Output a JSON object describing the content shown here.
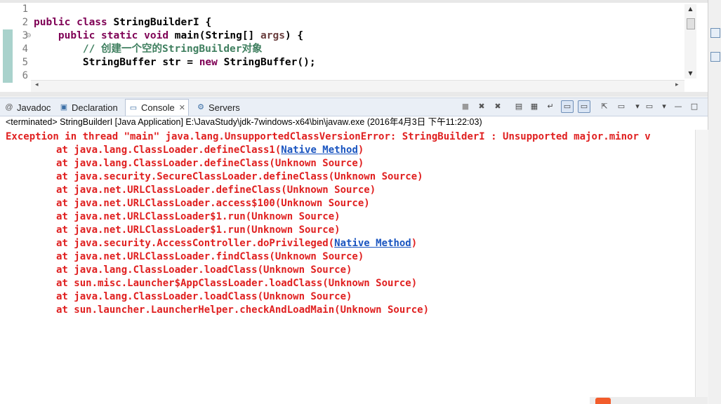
{
  "editor": {
    "line_numbers": [
      "1",
      "2",
      "3",
      "4",
      "5",
      "6"
    ],
    "lines": [
      {
        "parts": []
      },
      {
        "parts": [
          {
            "t": "public class ",
            "c": "kw"
          },
          {
            "t": "StringBuilderI {",
            "c": "plain"
          }
        ]
      },
      {
        "parts": [
          {
            "t": "    ",
            "c": "plain"
          },
          {
            "t": "public static void ",
            "c": "kw"
          },
          {
            "t": "main(String[] ",
            "c": "plain"
          },
          {
            "t": "args",
            "c": "param"
          },
          {
            "t": ") {",
            "c": "plain"
          }
        ]
      },
      {
        "parts": [
          {
            "t": "        // 创建一个空的StringBuilder对象",
            "c": "cmt"
          }
        ]
      },
      {
        "parts": [
          {
            "t": "        StringBuffer str = ",
            "c": "plain"
          },
          {
            "t": "new ",
            "c": "kw"
          },
          {
            "t": "StringBuffer();",
            "c": "plain"
          }
        ]
      },
      {
        "parts": []
      }
    ]
  },
  "tabs": [
    {
      "label": "Javadoc",
      "icon": "javadoc-icon",
      "glyph": "@"
    },
    {
      "label": "Declaration",
      "icon": "declaration-icon",
      "glyph": "▣"
    },
    {
      "label": "Console",
      "icon": "console-icon",
      "glyph": "▭",
      "active": true,
      "close": "✕"
    },
    {
      "label": "Servers",
      "icon": "servers-icon",
      "glyph": "⚙"
    }
  ],
  "console": {
    "header": "<terminated> StringBuilderI [Java Application] E:\\JavaStudy\\jdk-7windows-x64\\bin\\javaw.exe (2016年4月3日 下午11:22:03)",
    "exception": "Exception in thread \"main\" java.lang.UnsupportedClassVersionError: StringBuilderI : Unsupported major.minor v",
    "stack": [
      {
        "pre": "at java.lang.ClassLoader.defineClass1(",
        "link": "Native Method",
        "post": ")"
      },
      {
        "pre": "at java.lang.ClassLoader.defineClass(Unknown Source)"
      },
      {
        "pre": "at java.security.SecureClassLoader.defineClass(Unknown Source)"
      },
      {
        "pre": "at java.net.URLClassLoader.defineClass(Unknown Source)"
      },
      {
        "pre": "at java.net.URLClassLoader.access$100(Unknown Source)"
      },
      {
        "pre": "at java.net.URLClassLoader$1.run(Unknown Source)"
      },
      {
        "pre": "at java.net.URLClassLoader$1.run(Unknown Source)"
      },
      {
        "pre": "at java.security.AccessController.doPrivileged(",
        "link": "Native Method",
        "post": ")"
      },
      {
        "pre": "at java.net.URLClassLoader.findClass(Unknown Source)"
      },
      {
        "pre": "at java.lang.ClassLoader.loadClass(Unknown Source)"
      },
      {
        "pre": "at sun.misc.Launcher$AppClassLoader.loadClass(Unknown Source)"
      },
      {
        "pre": "at java.lang.ClassLoader.loadClass(Unknown Source)"
      },
      {
        "pre": "at sun.launcher.LauncherHelper.checkAndLoadMain(Unknown Source)"
      }
    ]
  },
  "toolbar": [
    {
      "icon": "terminate-icon",
      "glyph": "■"
    },
    {
      "icon": "remove-launch-icon",
      "glyph": "✖"
    },
    {
      "icon": "remove-all-terminated-icon",
      "glyph": "✖"
    },
    {
      "icon": "clear-console-icon",
      "glyph": "▤"
    },
    {
      "icon": "scroll-lock-icon",
      "glyph": "▦"
    },
    {
      "icon": "word-wrap-icon",
      "glyph": "↵"
    },
    {
      "icon": "show-console-on-stdout-icon",
      "glyph": "▭",
      "boxed": true
    },
    {
      "icon": "show-console-on-stderr-icon",
      "glyph": "▭",
      "boxed": true
    },
    {
      "icon": "pin-console-icon",
      "glyph": "⇱"
    },
    {
      "icon": "display-selected-console-icon",
      "glyph": "▭"
    },
    {
      "icon": "display-selected-console-dropdown-icon",
      "glyph": "▾"
    },
    {
      "icon": "open-console-icon",
      "glyph": "▭"
    },
    {
      "icon": "open-console-dropdown-icon",
      "glyph": "▾"
    },
    {
      "icon": "minimize-icon",
      "glyph": "—"
    },
    {
      "icon": "maximize-icon",
      "glyph": "□"
    }
  ]
}
